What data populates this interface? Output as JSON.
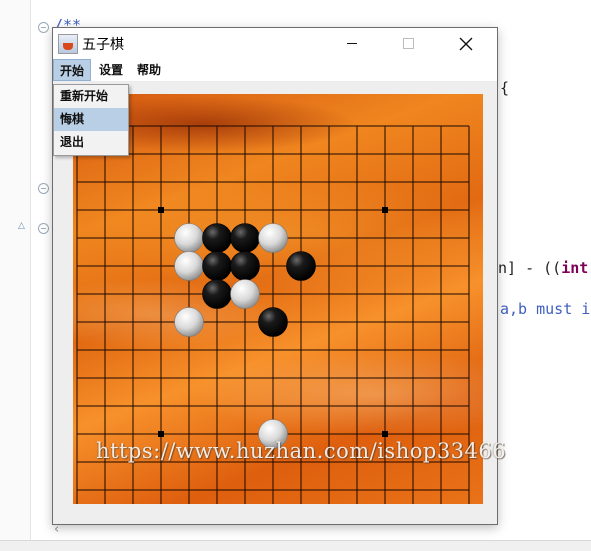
{
  "editor": {
    "line_comment": "/**",
    "line_brace": "{",
    "line_expr_pre": "n] - ((",
    "line_expr_kw": "int",
    "line_expr_post": "[",
    "line_must": "a,b must i"
  },
  "window": {
    "title": "五子棋"
  },
  "menu": {
    "items": [
      "开始",
      "设置",
      "帮助"
    ],
    "active_index": 0
  },
  "dropdown": {
    "items": [
      "重新开始",
      "悔棋",
      "退出"
    ],
    "highlighted_index": 1
  },
  "board": {
    "size": 15,
    "star_points": [
      [
        3,
        3
      ],
      [
        11,
        3
      ],
      [
        3,
        11
      ],
      [
        11,
        11
      ]
    ],
    "stones": [
      {
        "col": 4,
        "row": 4,
        "color": "white"
      },
      {
        "col": 5,
        "row": 4,
        "color": "black"
      },
      {
        "col": 6,
        "row": 4,
        "color": "black"
      },
      {
        "col": 7,
        "row": 4,
        "color": "white"
      },
      {
        "col": 4,
        "row": 5,
        "color": "white"
      },
      {
        "col": 5,
        "row": 5,
        "color": "black"
      },
      {
        "col": 6,
        "row": 5,
        "color": "black"
      },
      {
        "col": 8,
        "row": 5,
        "color": "black"
      },
      {
        "col": 5,
        "row": 6,
        "color": "black"
      },
      {
        "col": 6,
        "row": 6,
        "color": "white"
      },
      {
        "col": 4,
        "row": 7,
        "color": "white"
      },
      {
        "col": 7,
        "row": 7,
        "color": "black"
      },
      {
        "col": 7,
        "row": 11,
        "color": "white"
      }
    ]
  },
  "watermark": "https://www.huzhan.com/ishop33466"
}
